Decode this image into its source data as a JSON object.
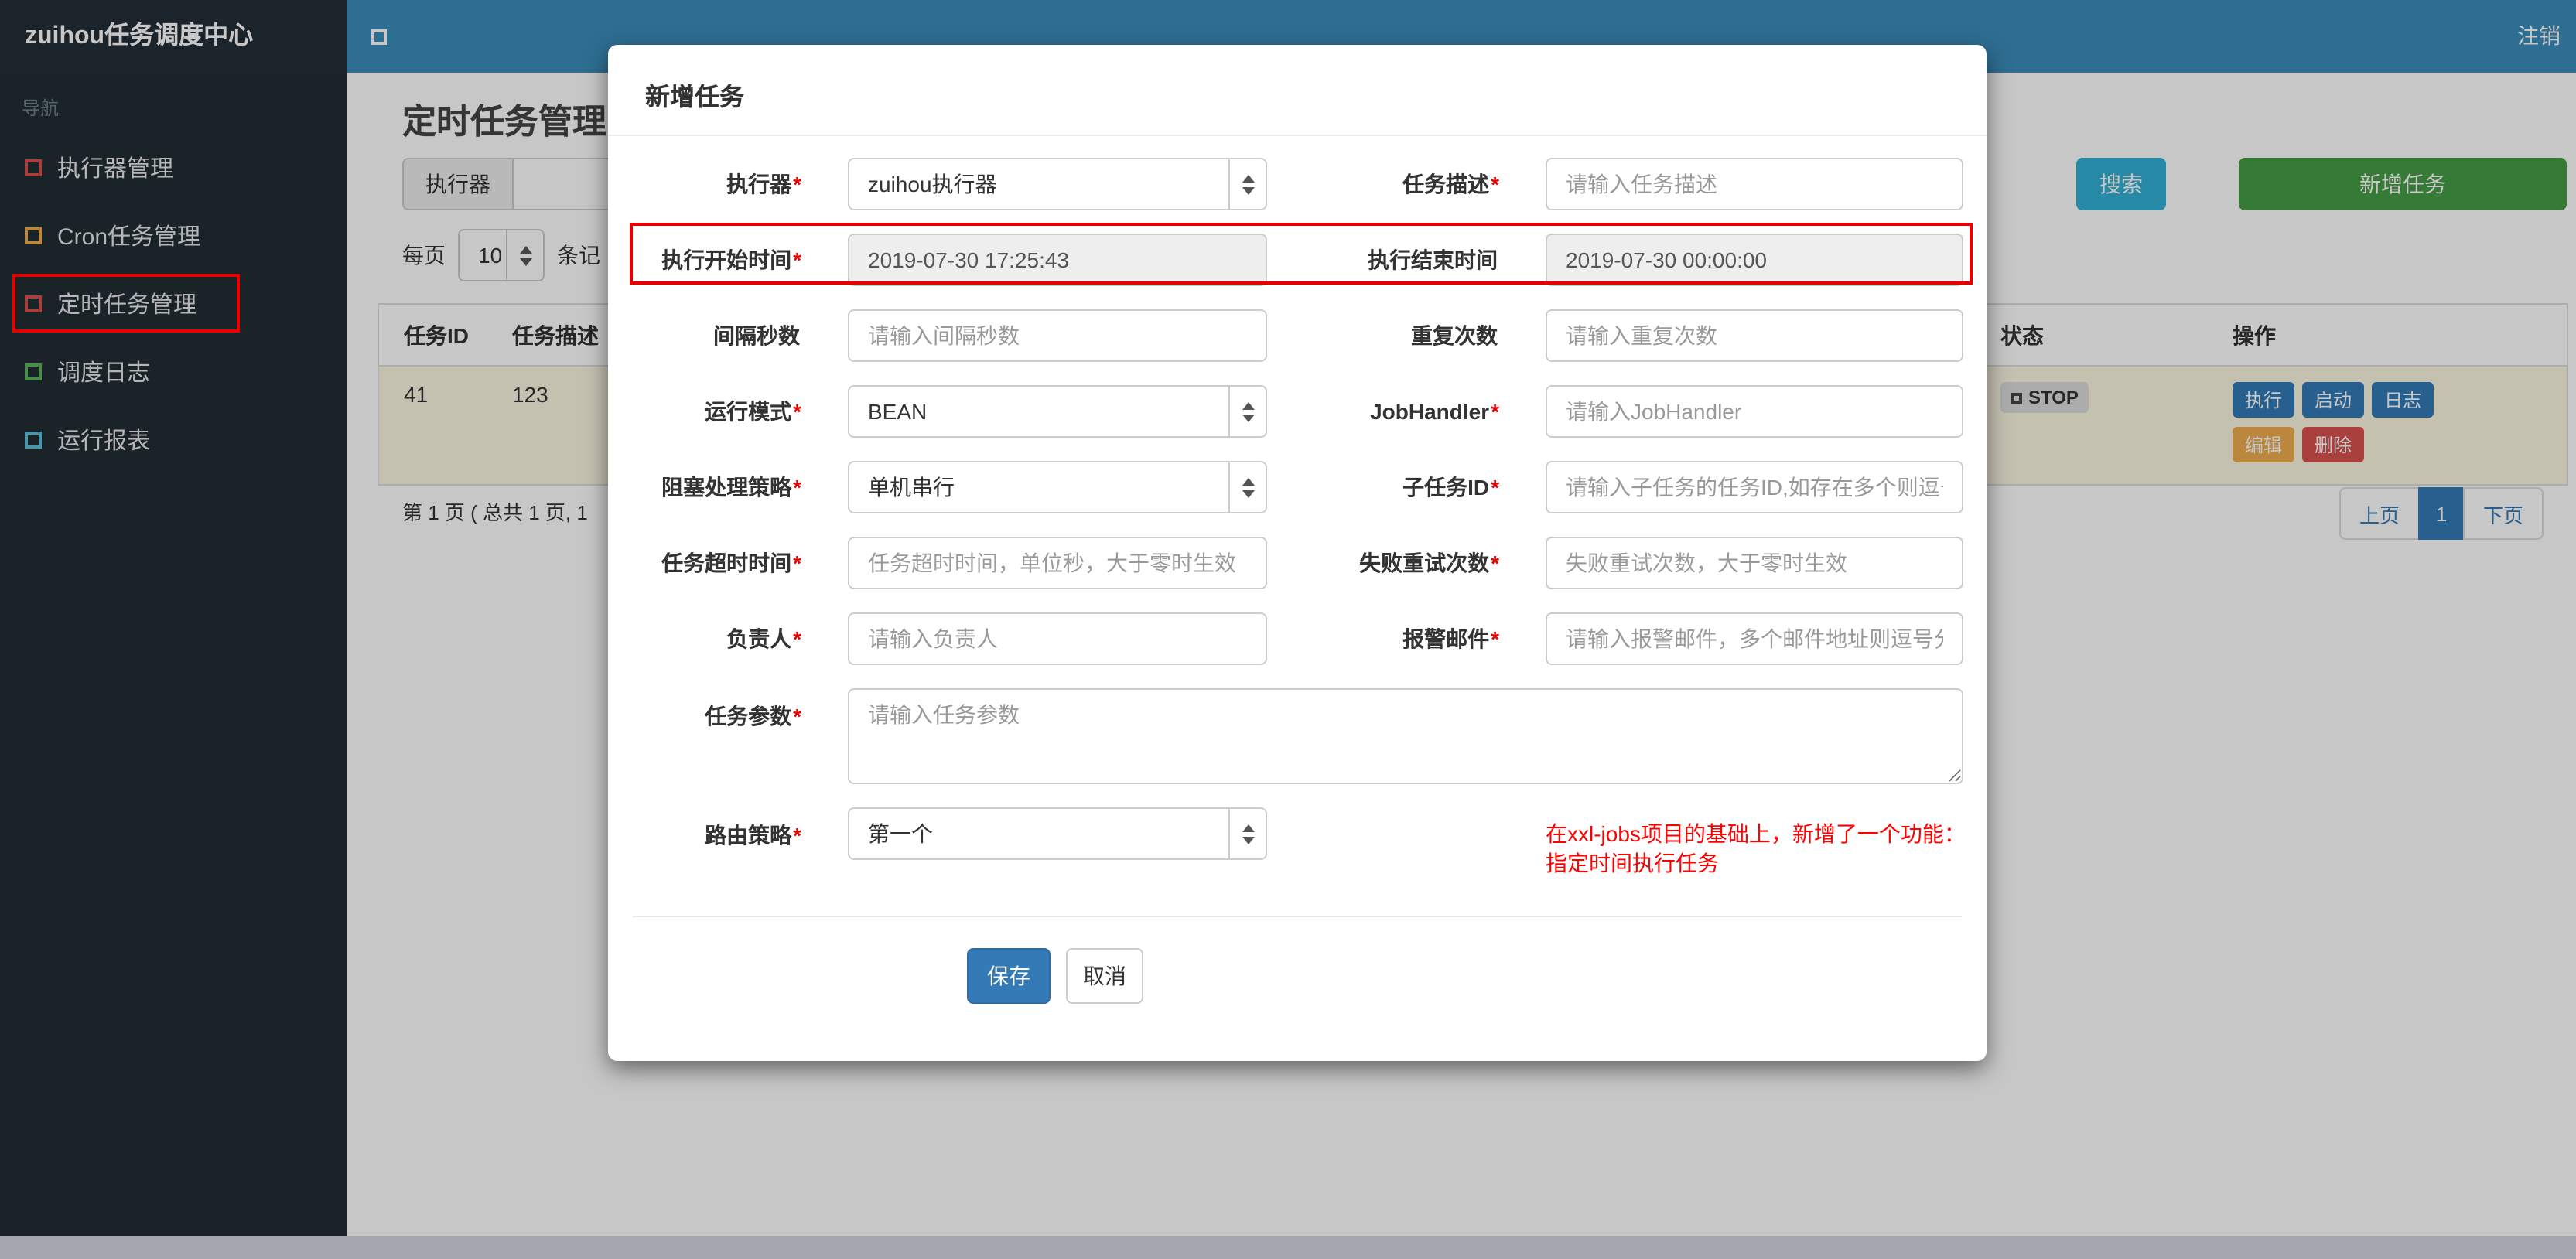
{
  "colors": {
    "navbar": "#3c8dbc",
    "brand_bg": "#252f38",
    "sidebar_bg": "#222d32",
    "primary": "#337ab7",
    "success": "#449d44",
    "info": "#31b0d5",
    "warning": "#f0ad4e",
    "danger": "#d9534f",
    "annotation_box": "#e60000",
    "note_text": "#ff0000"
  },
  "navbar": {
    "brand": "zuihou任务调度中心",
    "logout": "注销"
  },
  "sidebar": {
    "section": "导航",
    "items": [
      {
        "label": "执行器管理",
        "icon": "square-outline",
        "icon_color": "#d9534f"
      },
      {
        "label": "Cron任务管理",
        "icon": "square-outline",
        "icon_color": "#f0ad4e"
      },
      {
        "label": "定时任务管理",
        "icon": "square-outline",
        "icon_color": "#d9534f",
        "active": true
      },
      {
        "label": "调度日志",
        "icon": "square-outline",
        "icon_color": "#5cb85c"
      },
      {
        "label": "运行报表",
        "icon": "square-outline",
        "icon_color": "#5bc0de"
      }
    ]
  },
  "page": {
    "title": "定时任务管理",
    "filter": {
      "executor_label": "执行器",
      "search_button": "搜索",
      "add_button": "新增任务"
    },
    "per_page": {
      "prefix": "每页",
      "value": "10",
      "suffix": "条记"
    },
    "table": {
      "columns": [
        "任务ID",
        "任务描述",
        "状态",
        "操作"
      ],
      "row": {
        "id": "41",
        "desc": "123",
        "status": "STOP",
        "actions": [
          "执行",
          "启动",
          "日志",
          "编辑",
          "删除"
        ]
      }
    },
    "pagination": {
      "summary": "第 1 页 ( 总共 1 页, 1",
      "prev": "上页",
      "current": "1",
      "next": "下页"
    }
  },
  "modal": {
    "title": "新增任务",
    "rows": [
      {
        "left": {
          "label": "执行器",
          "star": "*",
          "type": "select",
          "value": "zuihou执行器"
        },
        "right": {
          "label": "任务描述",
          "star": "*",
          "type": "input",
          "placeholder": "请输入任务描述"
        }
      },
      {
        "left": {
          "label": "执行开始时间",
          "star": "*",
          "type": "readonly",
          "value": "2019-07-30 17:25:43"
        },
        "right": {
          "label": "执行结束时间",
          "star": "",
          "type": "readonly",
          "value": "2019-07-30 00:00:00"
        }
      },
      {
        "left": {
          "label": "间隔秒数",
          "star": "",
          "type": "input",
          "placeholder": "请输入间隔秒数"
        },
        "right": {
          "label": "重复次数",
          "star": "",
          "type": "input",
          "placeholder": "请输入重复次数"
        }
      },
      {
        "left": {
          "label": "运行模式",
          "star": "*",
          "type": "select",
          "value": "BEAN"
        },
        "right": {
          "label": "JobHandler",
          "star": "*",
          "type": "input",
          "placeholder": "请输入JobHandler"
        }
      },
      {
        "left": {
          "label": "阻塞处理策略",
          "star": "*",
          "type": "select",
          "value": "单机串行"
        },
        "right": {
          "label": "子任务ID",
          "star": "*",
          "type": "input",
          "placeholder": "请输入子任务的任务ID,如存在多个则逗号分隔"
        }
      },
      {
        "left": {
          "label": "任务超时时间",
          "star": "*",
          "type": "input",
          "placeholder": "任务超时时间，单位秒，大于零时生效"
        },
        "right": {
          "label": "失败重试次数",
          "star": "*",
          "type": "input",
          "placeholder": "失败重试次数，大于零时生效"
        }
      },
      {
        "left": {
          "label": "负责人",
          "star": "*",
          "type": "input",
          "placeholder": "请输入负责人"
        },
        "right": {
          "label": "报警邮件",
          "star": "*",
          "type": "input",
          "placeholder": "请输入报警邮件，多个邮件地址则逗号分隔"
        }
      }
    ],
    "params": {
      "label": "任务参数",
      "star": "*",
      "placeholder": "请输入任务参数"
    },
    "route": {
      "label": "路由策略",
      "star": "*",
      "value": "第一个"
    },
    "note": {
      "line1": "在xxl-jobs项目的基础上，新增了一个功能：",
      "line2": "指定时间执行任务"
    },
    "save": "保存",
    "cancel": "取消"
  }
}
